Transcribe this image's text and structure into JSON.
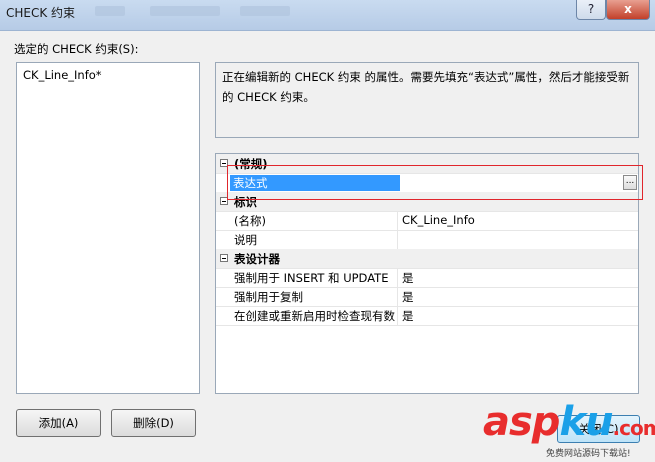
{
  "window": {
    "title": "CHECK 约束",
    "help_label": "?",
    "close_label": "x"
  },
  "constraints": {
    "label": "选定的 CHECK 约束(S):",
    "items": [
      "CK_Line_Info*"
    ]
  },
  "description": "正在编辑新的 CHECK 约束 的属性。需要先填充“表达式”属性，然后才能接受新的 CHECK 约束。",
  "properties": {
    "general": {
      "category": "(常规)",
      "expression_name": "表达式",
      "expression_value": "",
      "ellipsis": "..."
    },
    "identity": {
      "category": "标识",
      "name_label": "(名称)",
      "name_value": "CK_Line_Info",
      "desc_label": "说明",
      "desc_value": ""
    },
    "designer": {
      "category": "表设计器",
      "enforce_insert_label": "强制用于 INSERT 和 UPDATE",
      "enforce_insert_value": "是",
      "enforce_repl_label": "强制用于复制",
      "enforce_repl_value": "是",
      "check_existing_label": "在创建或重新启用时检查现有数",
      "check_existing_value": "是"
    }
  },
  "buttons": {
    "add": "添加(A)",
    "delete": "删除(D)",
    "close": "关闭(C)"
  },
  "watermark": {
    "brand_a": "asp",
    "brand_k": "ku",
    "brand_n": ".com",
    "sub": "免费网站源码下载站!"
  },
  "colors": {
    "selection": "#3399ff",
    "highlight_box": "#e0262c"
  }
}
